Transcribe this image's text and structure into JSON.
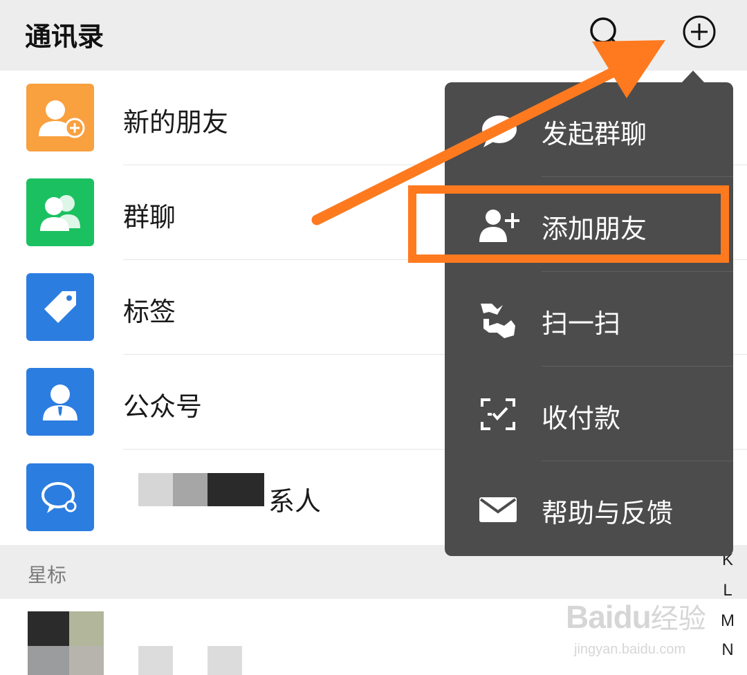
{
  "header": {
    "title": "通讯录"
  },
  "entries": [
    {
      "label": "新的朋友",
      "icon": "add-friend-icon",
      "color": "#f9a03f"
    },
    {
      "label": "群聊",
      "icon": "group-chat-icon",
      "color": "#1bc160"
    },
    {
      "label": "标签",
      "icon": "tag-icon",
      "color": "#2c7de0"
    },
    {
      "label": "公众号",
      "icon": "official-account-icon",
      "color": "#2c7de0"
    },
    {
      "label": "系人",
      "icon": "chat-contact-icon",
      "color": "#2c7de0"
    }
  ],
  "section": {
    "label": "星标"
  },
  "menu": {
    "items": [
      {
        "label": "发起群聊",
        "icon": "chat-bubble-icon"
      },
      {
        "label": "添加朋友",
        "icon": "add-person-icon"
      },
      {
        "label": "扫一扫",
        "icon": "scan-icon"
      },
      {
        "label": "收付款",
        "icon": "payment-icon"
      },
      {
        "label": "帮助与反馈",
        "icon": "mail-icon"
      }
    ]
  },
  "index": [
    "K",
    "L",
    "M",
    "N"
  ],
  "watermark": {
    "logo": "Baidu",
    "cn": "经验",
    "url": "jingyan.baidu.com"
  },
  "colors": {
    "accent": "#ff7a1f",
    "menu_bg": "#4c4c4c",
    "header_bg": "#ededed"
  }
}
